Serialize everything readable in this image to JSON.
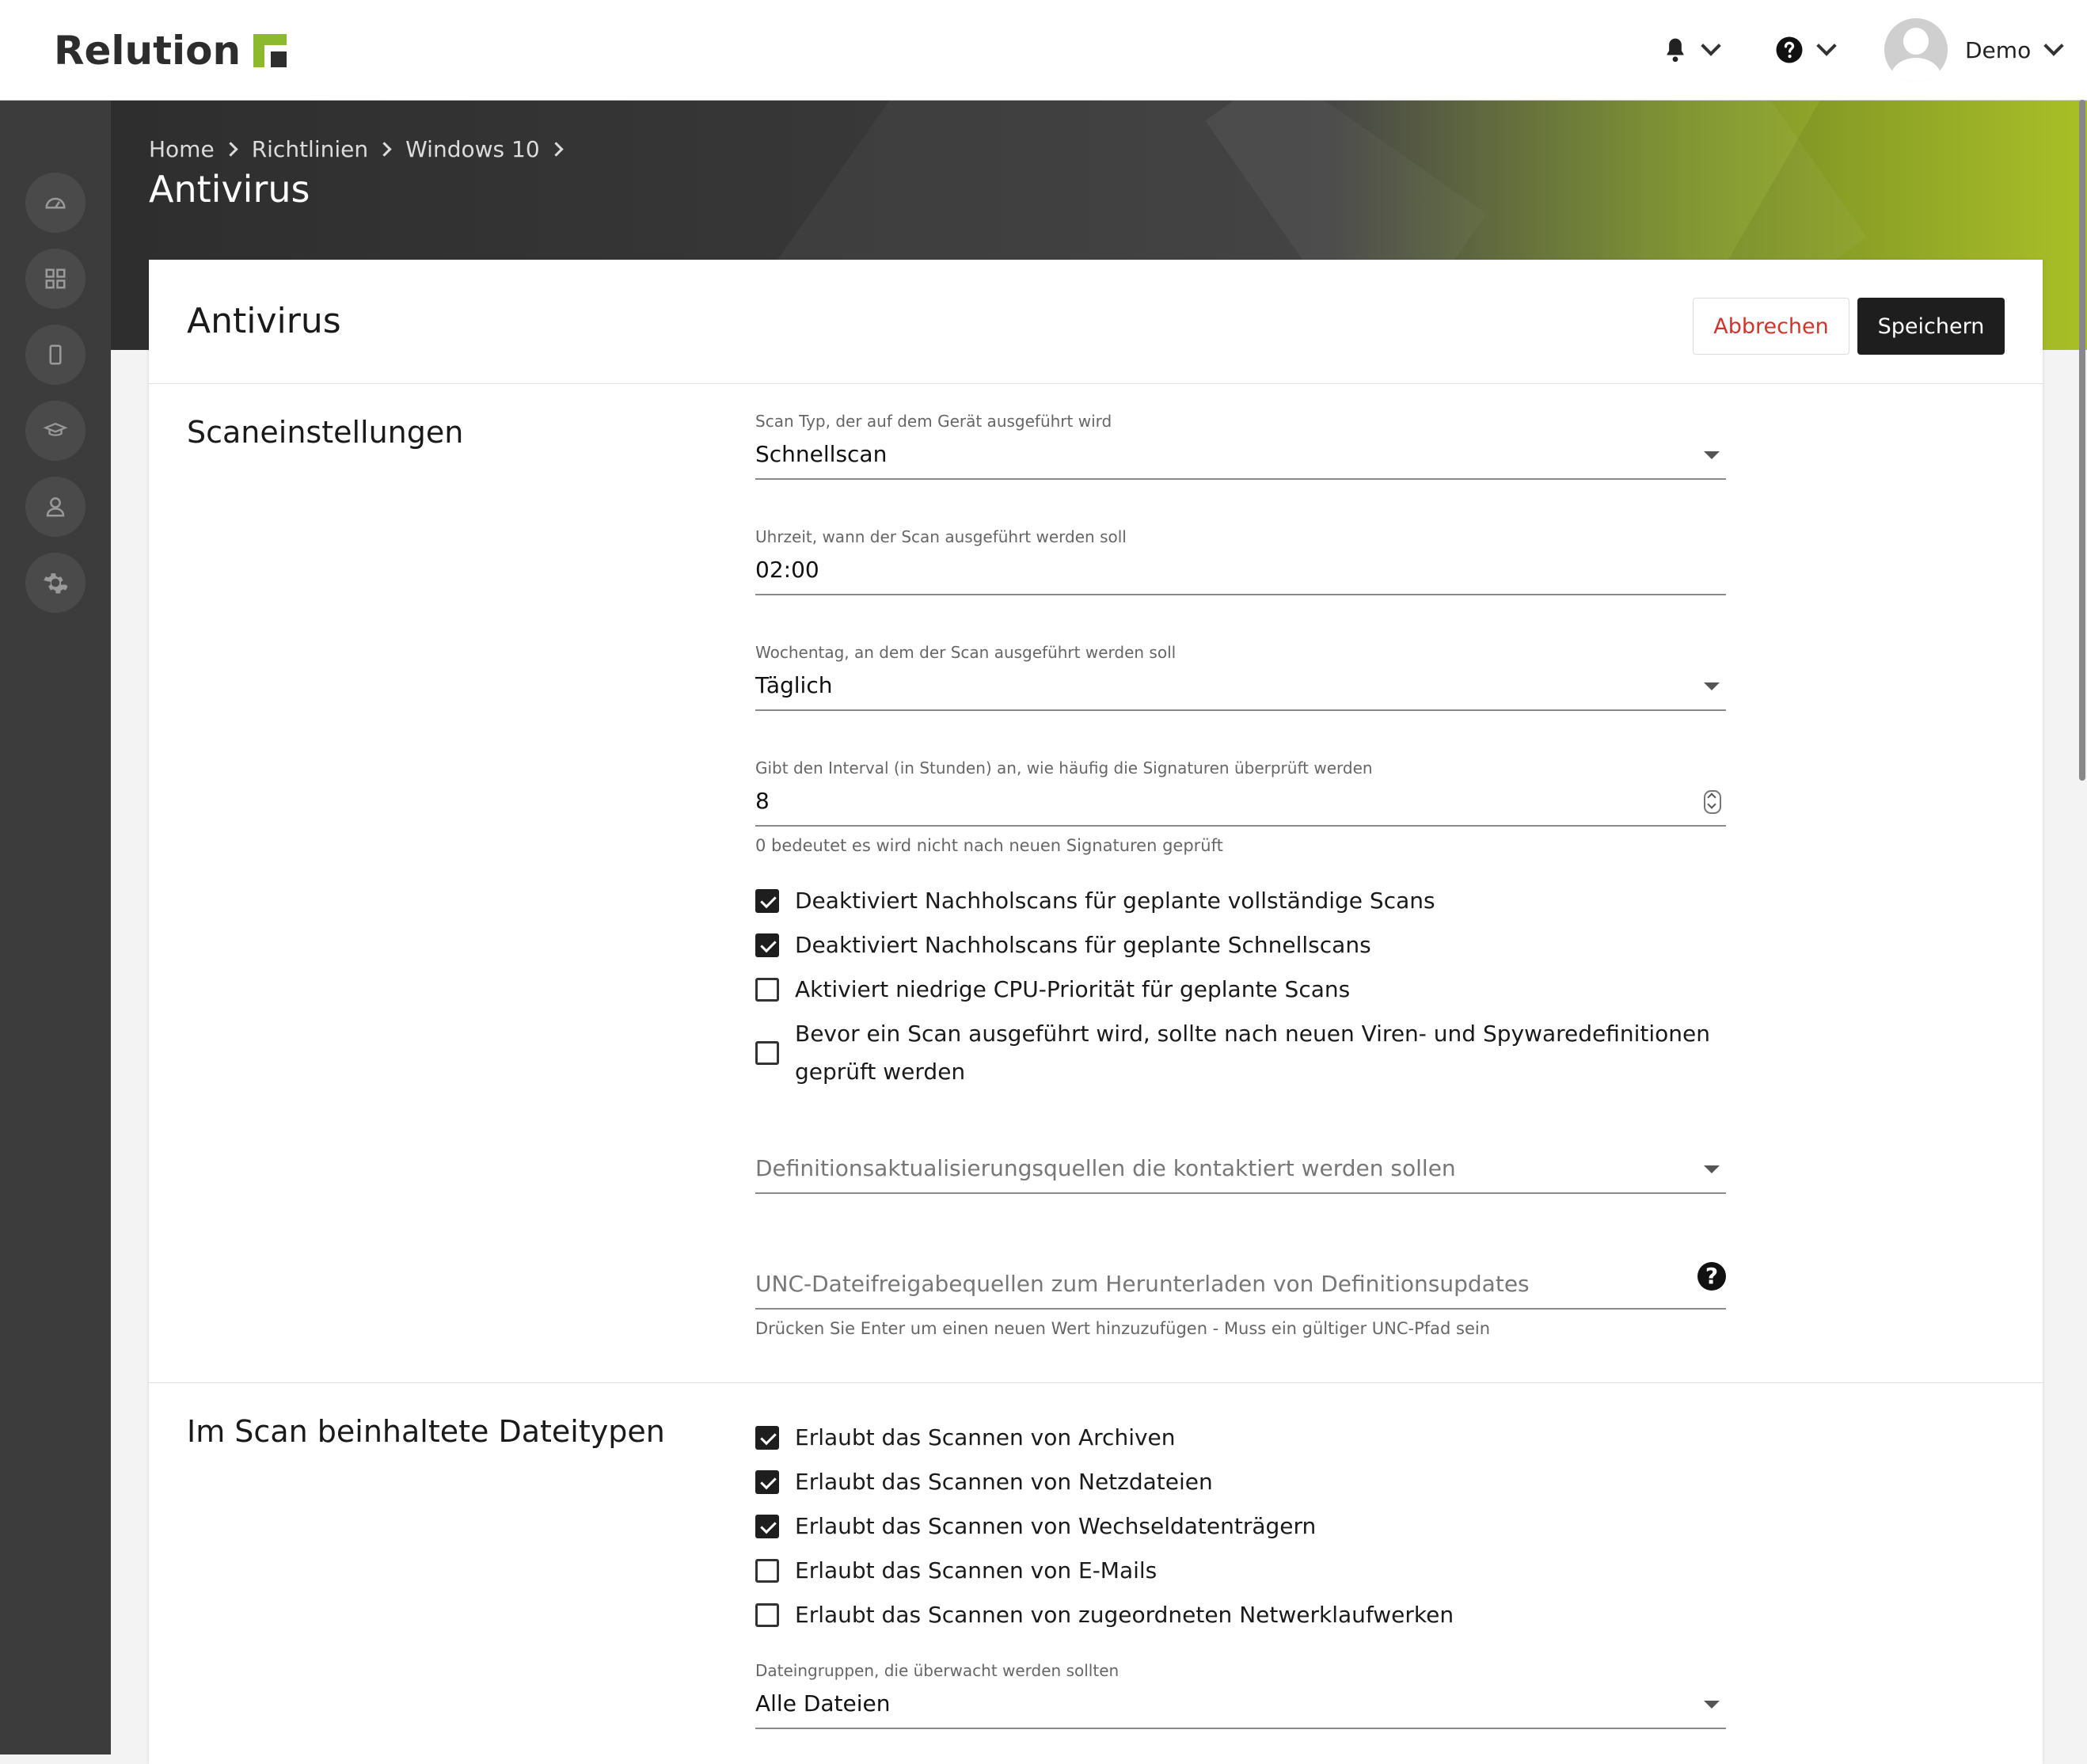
{
  "app": {
    "name": "Relution"
  },
  "topbar": {
    "bell_icon": "bell-icon",
    "help_icon": "question-circle-icon",
    "user": {
      "name": "Demo"
    }
  },
  "sidebar": {
    "items": [
      {
        "icon": "dashboard-icon"
      },
      {
        "icon": "apps-grid-icon"
      },
      {
        "icon": "device-icon"
      },
      {
        "icon": "education-cap-icon"
      },
      {
        "icon": "user-icon"
      },
      {
        "icon": "gear-icon"
      }
    ]
  },
  "breadcrumb": [
    "Home",
    "Richtlinien",
    "Windows 10"
  ],
  "hero": {
    "title": "Antivirus"
  },
  "card": {
    "title": "Antivirus",
    "cancel_label": "Abbrechen",
    "save_label": "Speichern"
  },
  "scan_settings": {
    "title": "Scaneinstellungen",
    "scan_type": {
      "label": "Scan Typ, der auf dem Gerät ausgeführt wird",
      "value": "Schnellscan"
    },
    "scan_time": {
      "label": "Uhrzeit, wann der Scan ausgeführt werden soll",
      "value": "02:00"
    },
    "weekday": {
      "label": "Wochentag, an dem der Scan ausgeführt werden soll",
      "value": "Täglich"
    },
    "interval": {
      "label": "Gibt den Interval (in Stunden) an, wie häufig die Signaturen überprüft werden",
      "value": "8",
      "hint": "0 bedeutet es wird nicht nach neuen Signaturen geprüft"
    },
    "checkboxes": [
      {
        "label": "Deaktiviert Nachholscans für geplante vollständige Scans",
        "checked": true
      },
      {
        "label": "Deaktiviert Nachholscans für geplante Schnellscans",
        "checked": true
      },
      {
        "label": "Aktiviert niedrige CPU-Priorität für geplante Scans",
        "checked": false
      },
      {
        "label": "Bevor ein Scan ausgeführt wird, sollte nach neuen Viren- und Spywaredefinitionen geprüft werden",
        "checked": false
      }
    ],
    "update_sources": {
      "placeholder": "Definitionsaktualisierungsquellen die kontaktiert werden sollen"
    },
    "unc_sources": {
      "placeholder": "UNC-Dateifreigabequellen zum Herunterladen von Definitionsupdates",
      "hint": "Drücken Sie Enter um einen neuen Wert hinzuzufügen - Muss ein gültiger UNC-Pfad sein"
    }
  },
  "file_types": {
    "title": "Im Scan beinhaltete Dateitypen",
    "checkboxes": [
      {
        "label": "Erlaubt das Scannen von Archiven",
        "checked": true
      },
      {
        "label": "Erlaubt das Scannen von Netzdateien",
        "checked": true
      },
      {
        "label": "Erlaubt das Scannen von Wechseldatenträgern",
        "checked": true
      },
      {
        "label": "Erlaubt das Scannen von E-Mails",
        "checked": false
      },
      {
        "label": "Erlaubt das Scannen von zugeordneten Netwerklaufwerken",
        "checked": false
      }
    ],
    "file_groups": {
      "label": "Dateingruppen, die überwacht werden sollten",
      "value": "Alle Dateien"
    }
  },
  "colors": {
    "accent": "#8db92e",
    "danger": "#d0342c",
    "primary_button": "#1e1e1e",
    "sidebar": "#3c3c3c"
  }
}
